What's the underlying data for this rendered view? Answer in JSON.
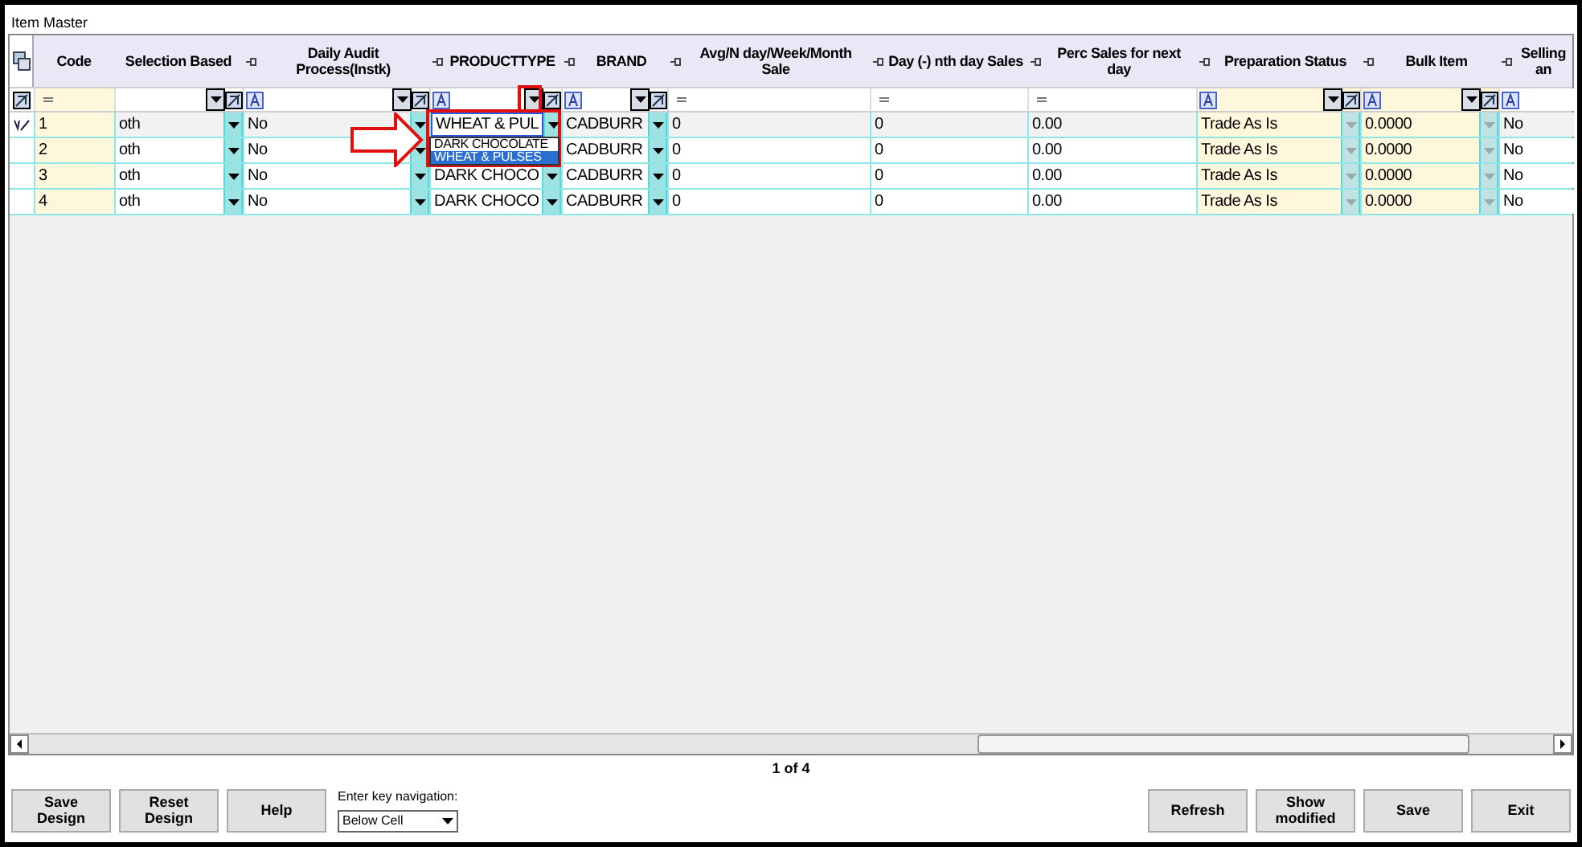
{
  "window": {
    "title": "Item Master"
  },
  "columns": [
    {
      "header": "Code",
      "pin": false,
      "kind": "key"
    },
    {
      "header": "Selection Based",
      "pin": false,
      "kind": "option"
    },
    {
      "header": "Daily Audit Process(Instk)",
      "pin": true,
      "kind": "lookup"
    },
    {
      "header": "PRODUCTTYPE",
      "pin": true,
      "kind": "lookup"
    },
    {
      "header": "BRAND",
      "pin": true,
      "kind": "lookup"
    },
    {
      "header": "Avg/N day/Week/Month Sale",
      "pin": true,
      "kind": "number"
    },
    {
      "header": "Day (-) nth day Sales",
      "pin": true,
      "kind": "number"
    },
    {
      "header": "Perc Sales for next day",
      "pin": true,
      "kind": "number"
    },
    {
      "header": "Preparation Status",
      "pin": true,
      "kind": "status"
    },
    {
      "header": "Bulk Item",
      "pin": true,
      "kind": "status"
    },
    {
      "header": "Selling an",
      "pin": true,
      "kind": "flag"
    }
  ],
  "rows": [
    {
      "current": true,
      "cells": [
        "1",
        "oth",
        "No",
        "WHEAT & PUL",
        "CADBURR",
        "0",
        "0",
        "0.00",
        "Trade As Is",
        "0.0000",
        "No"
      ]
    },
    {
      "current": false,
      "cells": [
        "2",
        "oth",
        "No",
        null,
        "CADBURR",
        "0",
        "0",
        "0.00",
        "Trade As Is",
        "0.0000",
        "No"
      ]
    },
    {
      "current": false,
      "cells": [
        "3",
        "oth",
        "No",
        "DARK CHOCO",
        "CADBURR",
        "0",
        "0",
        "0.00",
        "Trade As Is",
        "0.0000",
        "No"
      ]
    },
    {
      "current": false,
      "cells": [
        "4",
        "oth",
        "No",
        "DARK CHOCO",
        "CADBURR",
        "0",
        "0",
        "0.00",
        "Trade As Is",
        "0.0000",
        "No"
      ]
    }
  ],
  "dropdown": {
    "options": [
      {
        "label": "DARK CHOCOLATE",
        "selected": false
      },
      {
        "label": "WHEAT & PULSES",
        "selected": true
      }
    ]
  },
  "pager": "1 of 4",
  "left_buttons": [
    "Save Design",
    "Reset Design",
    "Help"
  ],
  "navigation": {
    "label": "Enter key navigation:",
    "value": "Below Cell"
  },
  "right_buttons": [
    "Refresh",
    "Show modified",
    "Save",
    "Exit"
  ]
}
